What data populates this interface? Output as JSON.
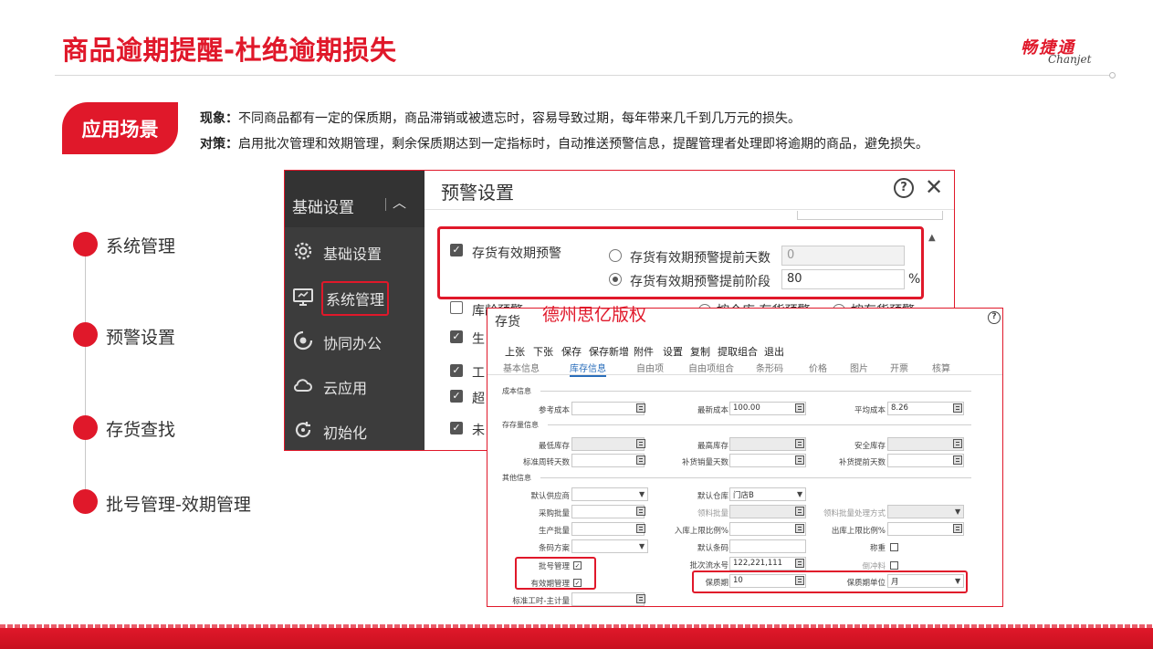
{
  "slide": {
    "title": "商品逾期提醒-杜绝逾期损失",
    "logo_cn": "畅捷通",
    "logo_en": "Chanjet",
    "scene_label": "应用场景",
    "phenomenon_label": "现象：",
    "phenomenon_text": "不同商品都有一定的保质期，商品滞销或被遗忘时，容易导致过期，每年带来几千到几万元的损失。",
    "strategy_label": "对策：",
    "strategy_text": "启用批次管理和效期管理，剩余保质期达到一定指标时，自动推送预警信息，提醒管理者处理即将逾期的商品，避免损失。",
    "timeline": [
      "系统管理",
      "预警设置",
      "存货查找",
      "批号管理-效期管理"
    ],
    "watermark": "德州思亿版权",
    "accent_color": "#e0182a"
  },
  "settings_window": {
    "sidebar_header": "基础设置",
    "sidebar_items": [
      {
        "label": "基础设置",
        "icon": "gear-icon"
      },
      {
        "label": "系统管理",
        "icon": "monitor-icon"
      },
      {
        "label": "协同办公",
        "icon": "collaboration-icon"
      },
      {
        "label": "云应用",
        "icon": "cloud-icon"
      },
      {
        "label": "初始化",
        "icon": "refresh-icon"
      }
    ],
    "dialog_title": "预警设置",
    "inventory_expiry_warning": "存货有效期预警",
    "option_days_label": "存货有效期预警提前天数",
    "option_days_value": "0",
    "option_stage_label": "存货有效期预警提前阶段",
    "option_stage_value": "80",
    "percent_sign": "%",
    "partial_row_1": "库龄预警",
    "partial_row_1_opt_a": "按仓库 存货预警",
    "partial_row_1_opt_b": "按存货预警",
    "partial_rows": [
      "生",
      "工",
      "超",
      "未"
    ]
  },
  "inventory_window": {
    "title": "存货",
    "toolbar": [
      "上张",
      "下张",
      "保存",
      "保存新增",
      "附件",
      "设置",
      "复制",
      "提取组合",
      "退出"
    ],
    "tabs": [
      "基本信息",
      "库存信息",
      "自由项",
      "自由项组合",
      "条形码",
      "价格",
      "图片",
      "开票",
      "核算"
    ],
    "active_tab": "库存信息",
    "sections": {
      "cost": "成本信息",
      "stock": "存存量信息",
      "other": "其他信息"
    },
    "fields": {
      "ref_cost": "参考成本",
      "latest_cost": "最新成本",
      "latest_cost_value": "100.00",
      "avg_cost": "平均成本",
      "avg_cost_value": "8.26",
      "min_stock": "最低库存",
      "max_stock": "最高库存",
      "safety_stock": "安全库存",
      "std_turnover_days": "标准周转天数",
      "replenish_sales_days": "补货销量天数",
      "replenish_lead_days": "补货提前天数",
      "default_supplier": "默认供应商",
      "default_warehouse": "默认仓库",
      "default_warehouse_value": "门店B",
      "purchase_batch": "采购批量",
      "material_batch": "领料批量",
      "material_batch_mode": "领料批量处理方式",
      "production_batch": "生产批量",
      "inbound_upper_ratio": "入库上限比例%",
      "outbound_upper_ratio": "出库上限比例%",
      "barcode_scheme": "条码方案",
      "default_barcode": "默认条码",
      "weigh": "称重",
      "batch_management": "批号管理",
      "batch_serial": "批次流水号",
      "batch_serial_value": "122,221,111",
      "backflush": "倒冲料",
      "expiry_management": "有效期管理",
      "shelf_life": "保质期",
      "shelf_life_value": "10",
      "shelf_life_unit": "保质期单位",
      "shelf_life_unit_value": "月",
      "std_hours": "标准工时-主计量"
    }
  }
}
